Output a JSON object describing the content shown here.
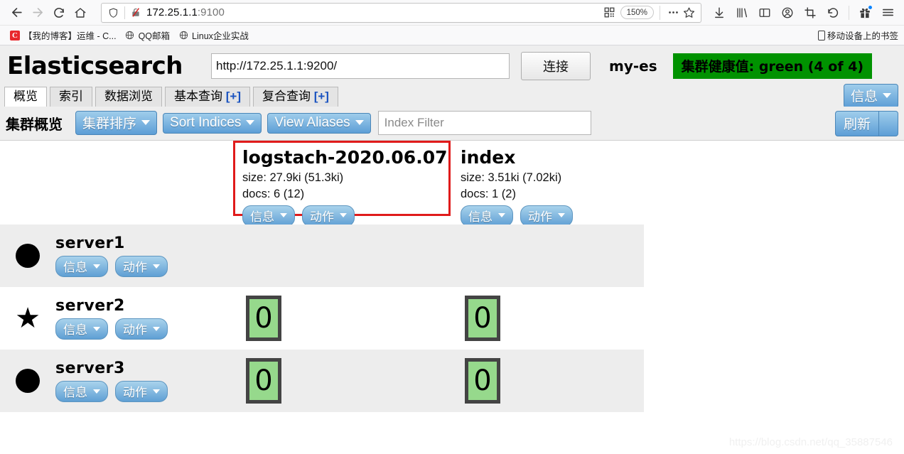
{
  "browser": {
    "nav": {
      "back": "back-arrow",
      "forward": "forward-arrow",
      "reload": "reload",
      "home": "home"
    },
    "url": {
      "host": "172.25.1.1",
      "port": ":9100",
      "zoom": "150%"
    },
    "bookmarks": [
      {
        "favicon": "C",
        "label": "【我的博客】运维 - C..."
      },
      {
        "favicon": "globe",
        "label": "QQ邮箱"
      },
      {
        "favicon": "globe",
        "label": "Linux企业实战"
      }
    ],
    "bookmarks_right": "移动设备上的书签"
  },
  "app": {
    "logo": "Elasticsearch",
    "url_value": "http://172.25.1.1:9200/",
    "connect_label": "连接",
    "cluster_name": "my-es",
    "health": "集群健康值: green (4 of 4)",
    "health_color": "#009200",
    "tabs": [
      {
        "label": "概览",
        "active": true
      },
      {
        "label": "索引",
        "active": false
      },
      {
        "label": "数据浏览",
        "active": false
      },
      {
        "label": "基本查询",
        "suffix": "[+]",
        "active": false
      },
      {
        "label": "复合查询",
        "suffix": "[+]",
        "active": false
      }
    ],
    "tab_right_button": "信息",
    "toolbar": {
      "title": "集群概览",
      "sort_cluster": "集群排序",
      "sort_indices": "Sort Indices",
      "view_aliases": "View Aliases",
      "filter_placeholder": "Index Filter",
      "refresh": "刷新"
    },
    "indices": [
      {
        "name": "logstach-2020.06.07",
        "size": "size: 27.9ki (51.3ki)",
        "docs": "docs: 6 (12)",
        "info": "信息",
        "action": "动作",
        "highlighted": true
      },
      {
        "name": "index",
        "size": "size: 3.51ki (7.02ki)",
        "docs": "docs: 1 (2)",
        "info": "信息",
        "action": "动作",
        "highlighted": false
      }
    ],
    "nodes": [
      {
        "name": "server1",
        "icon": "circle",
        "info": "信息",
        "action": "动作",
        "shards": [
          "",
          ""
        ],
        "shaded": true
      },
      {
        "name": "server2",
        "icon": "star",
        "info": "信息",
        "action": "动作",
        "shards": [
          "0",
          "0"
        ],
        "shaded": false
      },
      {
        "name": "server3",
        "icon": "circle",
        "info": "信息",
        "action": "动作",
        "shards": [
          "0",
          "0"
        ],
        "shaded": true
      }
    ],
    "watermark": "https://blog.csdn.net/qq_35887546"
  }
}
